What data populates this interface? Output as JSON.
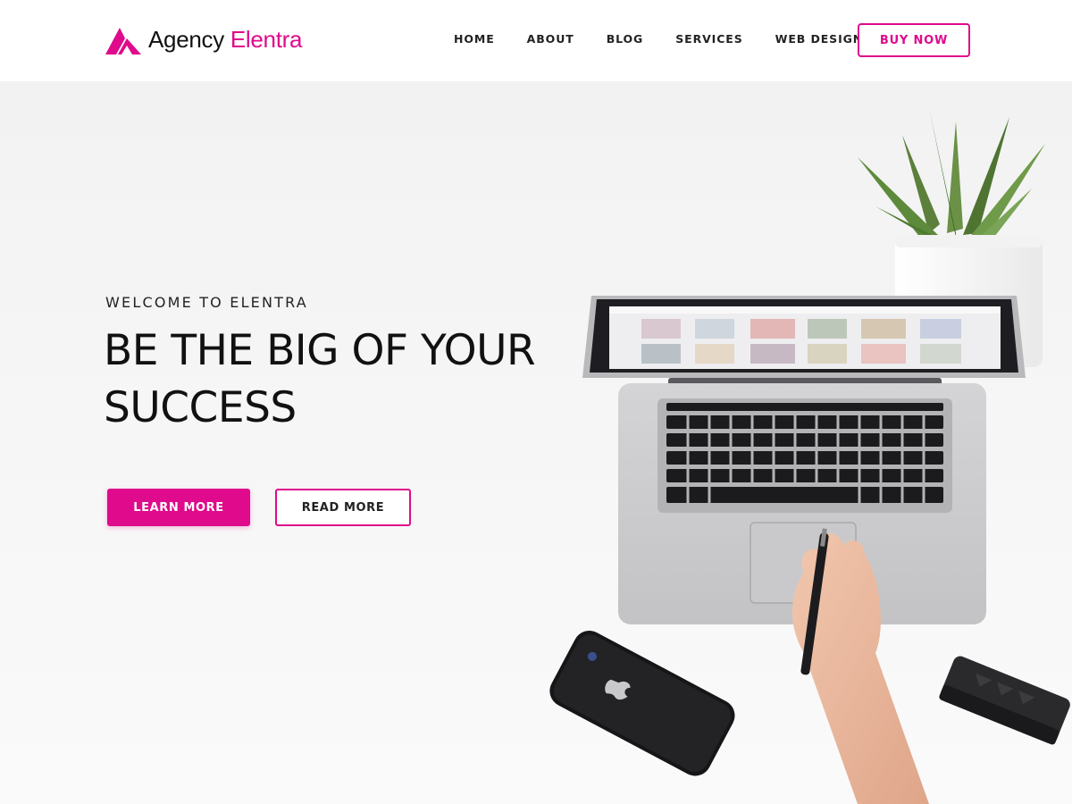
{
  "colors": {
    "accent": "#df0a8c",
    "text": "#111111",
    "header_bg": "#ffffff",
    "hero_bg": "#f4f4f4"
  },
  "header": {
    "logo": {
      "icon": "brand-a-icon",
      "text_primary": "Agency",
      "text_accent": "Elentra"
    },
    "nav": [
      {
        "label": "HOME"
      },
      {
        "label": "ABOUT"
      },
      {
        "label": "BLOG"
      },
      {
        "label": "SERVICES"
      },
      {
        "label": "WEB DESIGN"
      }
    ],
    "cta_label": "BUY NOW"
  },
  "hero": {
    "eyebrow": "WELCOME TO ELENTRA",
    "title_line1": "BE THE BIG OF YOUR",
    "title_line2": "SUCCESS",
    "primary_button": "LEARN MORE",
    "secondary_button": "READ MORE",
    "image": {
      "description_icons": [
        "laptop-image",
        "plant-image",
        "phone-image",
        "speaker-image",
        "hand-with-pen-image"
      ]
    }
  }
}
